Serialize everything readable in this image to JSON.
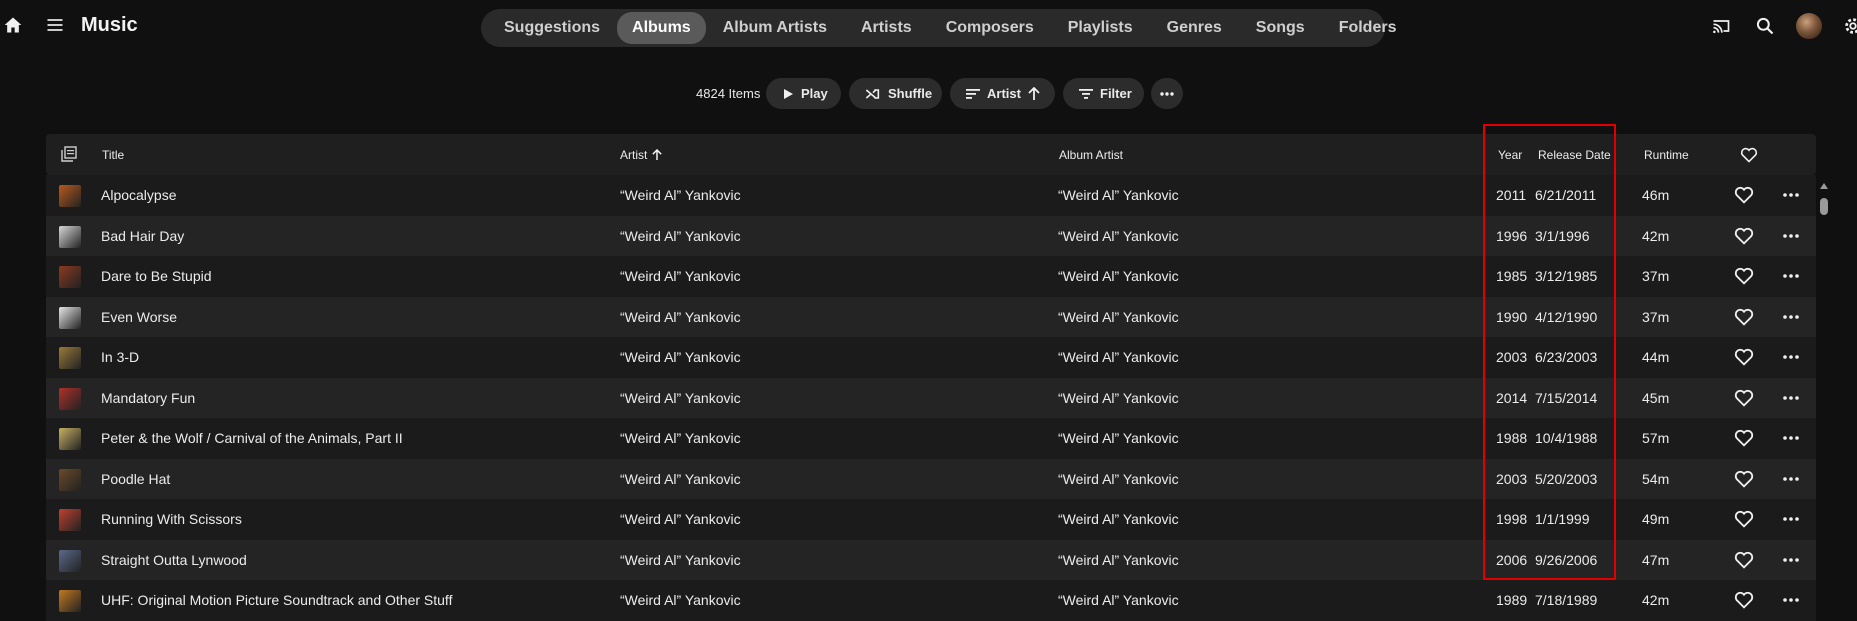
{
  "app": {
    "title": "Music"
  },
  "tabs": [
    "Suggestions",
    "Albums",
    "Album Artists",
    "Artists",
    "Composers",
    "Playlists",
    "Genres",
    "Songs",
    "Folders"
  ],
  "active_tab": "Albums",
  "toolbar": {
    "items_count": "4824 Items",
    "play_label": "Play",
    "shuffle_label": "Shuffle",
    "sort_label": "Artist",
    "filter_label": "Filter"
  },
  "table": {
    "headers": {
      "title": "Title",
      "artist": "Artist",
      "album_artist": "Album Artist",
      "year": "Year",
      "release_date": "Release Date",
      "runtime": "Runtime"
    },
    "rows": [
      {
        "title": "Alpocalypse",
        "artist": "“Weird Al” Yankovic",
        "album_artist": "“Weird Al” Yankovic",
        "year": "2011",
        "release_date": "6/21/2011",
        "runtime": "46m",
        "thumb_color": "#b85a1c"
      },
      {
        "title": "Bad Hair Day",
        "artist": "“Weird Al” Yankovic",
        "album_artist": "“Weird Al” Yankovic",
        "year": "1996",
        "release_date": "3/1/1996",
        "runtime": "42m",
        "thumb_color": "#d8d8d8"
      },
      {
        "title": "Dare to Be Stupid",
        "artist": "“Weird Al” Yankovic",
        "album_artist": "“Weird Al” Yankovic",
        "year": "1985",
        "release_date": "3/12/1985",
        "runtime": "37m",
        "thumb_color": "#8a3a20"
      },
      {
        "title": "Even Worse",
        "artist": "“Weird Al” Yankovic",
        "album_artist": "“Weird Al” Yankovic",
        "year": "1990",
        "release_date": "4/12/1990",
        "runtime": "37m",
        "thumb_color": "#e6e6e6"
      },
      {
        "title": "In 3-D",
        "artist": "“Weird Al” Yankovic",
        "album_artist": "“Weird Al” Yankovic",
        "year": "2003",
        "release_date": "6/23/2003",
        "runtime": "44m",
        "thumb_color": "#9a7a3a"
      },
      {
        "title": "Mandatory Fun",
        "artist": "“Weird Al” Yankovic",
        "album_artist": "“Weird Al” Yankovic",
        "year": "2014",
        "release_date": "7/15/2014",
        "runtime": "45m",
        "thumb_color": "#b0302a"
      },
      {
        "title": "Peter & the Wolf / Carnival of the Animals, Part II",
        "artist": "“Weird Al” Yankovic",
        "album_artist": "“Weird Al” Yankovic",
        "year": "1988",
        "release_date": "10/4/1988",
        "runtime": "57m",
        "thumb_color": "#c8b060"
      },
      {
        "title": "Poodle Hat",
        "artist": "“Weird Al” Yankovic",
        "album_artist": "“Weird Al” Yankovic",
        "year": "2003",
        "release_date": "5/20/2003",
        "runtime": "54m",
        "thumb_color": "#6a4a2a"
      },
      {
        "title": "Running With Scissors",
        "artist": "“Weird Al” Yankovic",
        "album_artist": "“Weird Al” Yankovic",
        "year": "1998",
        "release_date": "1/1/1999",
        "runtime": "49m",
        "thumb_color": "#c04030"
      },
      {
        "title": "Straight Outta Lynwood",
        "artist": "“Weird Al” Yankovic",
        "album_artist": "“Weird Al” Yankovic",
        "year": "2006",
        "release_date": "9/26/2006",
        "runtime": "47m",
        "thumb_color": "#5a6a8a"
      },
      {
        "title": "UHF: Original Motion Picture Soundtrack and Other Stuff",
        "artist": "“Weird Al” Yankovic",
        "album_artist": "“Weird Al” Yankovic",
        "year": "1989",
        "release_date": "7/18/1989",
        "runtime": "42m",
        "thumb_color": "#c07a20"
      }
    ]
  },
  "colors": {
    "highlight_box": "#e00000",
    "background": "#101010"
  },
  "icons": [
    "home-icon",
    "menu-icon",
    "cast-icon",
    "search-icon",
    "avatar",
    "settings-icon",
    "play-icon",
    "shuffle-icon",
    "sort-icon",
    "arrow-up-icon",
    "filter-icon",
    "more-icon",
    "heart-icon"
  ]
}
